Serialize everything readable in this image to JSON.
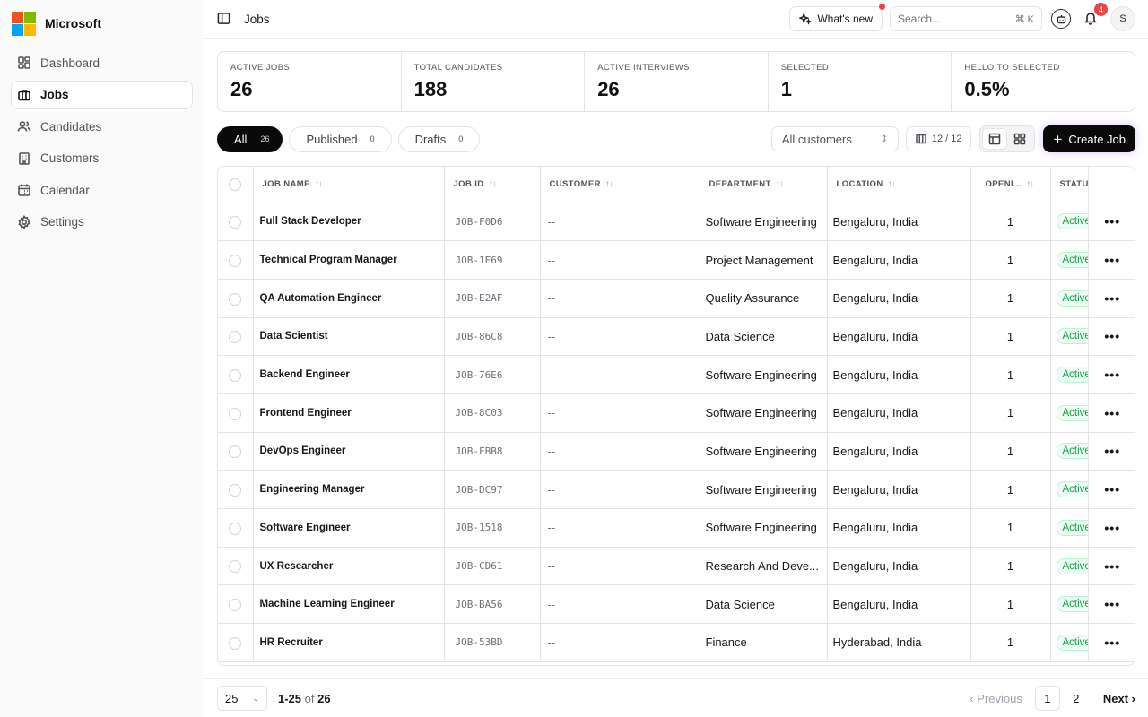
{
  "brand": {
    "name": "Microsoft",
    "logo_colors": [
      "#f25022",
      "#7fba00",
      "#00a4ef",
      "#ffb900"
    ]
  },
  "sidebar": {
    "items": [
      {
        "label": "Dashboard",
        "icon": "dashboard-icon",
        "active": false
      },
      {
        "label": "Jobs",
        "icon": "briefcase-icon",
        "active": true
      },
      {
        "label": "Candidates",
        "icon": "users-icon",
        "active": false
      },
      {
        "label": "Customers",
        "icon": "building-icon",
        "active": false
      },
      {
        "label": "Calendar",
        "icon": "calendar-icon",
        "active": false
      },
      {
        "label": "Settings",
        "icon": "gear-icon",
        "active": false
      }
    ]
  },
  "topbar": {
    "title": "Jobs",
    "whats_new": "What's new",
    "search_placeholder": "Search...",
    "search_shortcut": "⌘ K",
    "notification_count": "4",
    "avatar_initial": "S"
  },
  "stats": [
    {
      "label": "ACTIVE JOBS",
      "value": "26"
    },
    {
      "label": "TOTAL CANDIDATES",
      "value": "188"
    },
    {
      "label": "ACTIVE INTERVIEWS",
      "value": "26"
    },
    {
      "label": "SELECTED",
      "value": "1"
    },
    {
      "label": "HELLO TO SELECTED",
      "value": "0.5%"
    }
  ],
  "filters": {
    "tabs": [
      {
        "label": "All",
        "count": "26"
      },
      {
        "label": "Published",
        "count": "0"
      },
      {
        "label": "Drafts",
        "count": "0"
      }
    ],
    "customer_select": "All customers",
    "columns_count": "12 / 12",
    "create_label": "Create Job"
  },
  "table": {
    "headers": [
      "JOB NAME",
      "JOB ID",
      "CUSTOMER",
      "DEPARTMENT",
      "LOCATION",
      "OPENI...",
      "STATU"
    ],
    "rows": [
      {
        "name": "Full Stack Developer",
        "id": "JOB-F0D6",
        "customer": "--",
        "department": "Software Engineering",
        "location": "Bengaluru, India",
        "openings": "1",
        "status": "Active"
      },
      {
        "name": "Technical Program Manager",
        "id": "JOB-1E69",
        "customer": "--",
        "department": "Project Management",
        "location": "Bengaluru, India",
        "openings": "1",
        "status": "Active"
      },
      {
        "name": "QA Automation Engineer",
        "id": "JOB-E2AF",
        "customer": "--",
        "department": "Quality Assurance",
        "location": "Bengaluru, India",
        "openings": "1",
        "status": "Active"
      },
      {
        "name": "Data Scientist",
        "id": "JOB-86C8",
        "customer": "--",
        "department": "Data Science",
        "location": "Bengaluru, India",
        "openings": "1",
        "status": "Active"
      },
      {
        "name": "Backend Engineer",
        "id": "JOB-76E6",
        "customer": "--",
        "department": "Software Engineering",
        "location": "Bengaluru, India",
        "openings": "1",
        "status": "Active"
      },
      {
        "name": "Frontend Engineer",
        "id": "JOB-8C03",
        "customer": "--",
        "department": "Software Engineering",
        "location": "Bengaluru, India",
        "openings": "1",
        "status": "Active"
      },
      {
        "name": "DevOps Engineer",
        "id": "JOB-FBB8",
        "customer": "--",
        "department": "Software Engineering",
        "location": "Bengaluru, India",
        "openings": "1",
        "status": "Active"
      },
      {
        "name": "Engineering Manager",
        "id": "JOB-DC97",
        "customer": "--",
        "department": "Software Engineering",
        "location": "Bengaluru, India",
        "openings": "1",
        "status": "Active"
      },
      {
        "name": "Software Engineer",
        "id": "JOB-1518",
        "customer": "--",
        "department": "Software Engineering",
        "location": "Bengaluru, India",
        "openings": "1",
        "status": "Active"
      },
      {
        "name": "UX Researcher",
        "id": "JOB-CD61",
        "customer": "--",
        "department": "Research And Deve...",
        "location": "Bengaluru, India",
        "openings": "1",
        "status": "Active"
      },
      {
        "name": "Machine Learning Engineer",
        "id": "JOB-BA56",
        "customer": "--",
        "department": "Data Science",
        "location": "Bengaluru, India",
        "openings": "1",
        "status": "Active"
      },
      {
        "name": "HR Recruiter",
        "id": "JOB-53BD",
        "customer": "--",
        "department": "Finance",
        "location": "Hyderabad, India",
        "openings": "1",
        "status": "Active"
      }
    ]
  },
  "footer": {
    "per_page": "25",
    "range": "1-25",
    "of": "of",
    "total": "26",
    "prev": "Previous",
    "pages": [
      "1",
      "2"
    ],
    "next": "Next"
  }
}
